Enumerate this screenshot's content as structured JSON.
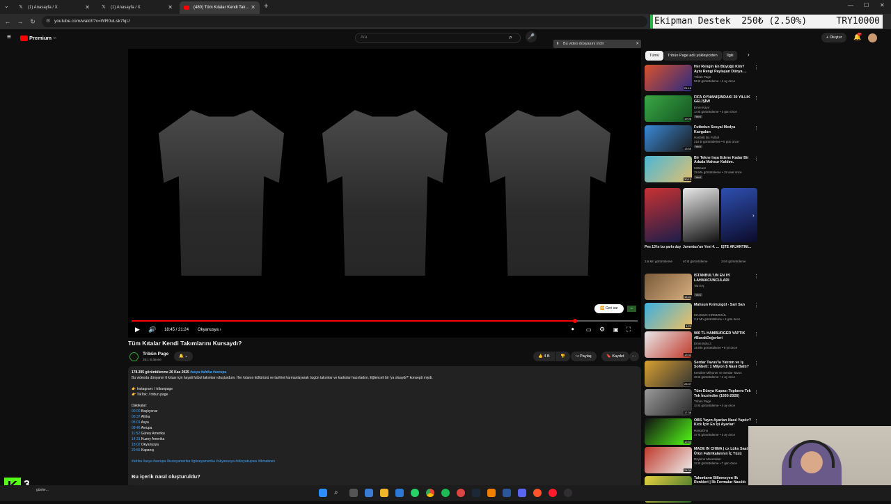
{
  "browser": {
    "tabs": [
      {
        "label": "(1) Anasayfa / X",
        "icon": "x-logo-icon"
      },
      {
        "label": "(1) Anasayfa / X",
        "icon": "x-logo-icon"
      },
      {
        "label": "(480) Tüm Kıtalar Kendi Tak...",
        "icon": "youtube-icon"
      }
    ],
    "url": "youtube.com/watch?v=WR0uLsk7lqU"
  },
  "ticker": {
    "text": "Ekipman Destek  250₺ (2.50%)",
    "goal": "TRY10000"
  },
  "youtube": {
    "brand": "Premium",
    "brand_sup": "TR",
    "search_placeholder": "Ara",
    "create_label": "Oluştur",
    "notif_count": "9+",
    "download_banner": "Bu video dosyasını indir",
    "video": {
      "time": "18:45 / 21:24",
      "chapter": "Okyanusya",
      "skip": "Geri sar",
      "progress": 0.876,
      "title": "Tüm Kıtalar Kendi Takımlarını Kursaydı?"
    },
    "channel": {
      "name": "Tribün Page",
      "subs": "25,1 B abone"
    },
    "actions": {
      "likes": "4 B",
      "share": "Paylaş",
      "save": "Kaydet"
    },
    "description": {
      "stats": "178.395 görüntülenme  26 Kas 2025",
      "tags_inline": "#asya #afrika #avrupa",
      "text": "Bu videoda dünyanın 6 kıtası için hayali futbol takımları oluşturdum. Her kıtanın kültürünü ve tarihini harmanlayarak özgün takımlar ve kadrolar hazırladım. Eğlenceli bir 'ya olsaydı?' konsepti miydi.",
      "instagram": "Instagram:  / tribunpage",
      "tiktok": "TikTok:  / tribun.page",
      "chapters_title": "Dakikalar:",
      "chapters": [
        {
          "t": "00:00",
          "l": "Başlıyoruz"
        },
        {
          "t": "00:37",
          "l": "Afrika"
        },
        {
          "t": "05:01",
          "l": "Asya"
        },
        {
          "t": "08:46",
          "l": "Avrupa"
        },
        {
          "t": "11:52",
          "l": "Güney Amerika"
        },
        {
          "t": "14:31",
          "l": "Kuzey Amerika"
        },
        {
          "t": "18:02",
          "l": "Okyanusya"
        },
        {
          "t": "20:55",
          "l": "Kapanış"
        }
      ],
      "hashtags": "#afrika #asya #avrupa #kuzeyamerika #güneyamerika #okyanusya #dünyakupası #tkmaknen",
      "section_title": "Bu içerik nasıl oluşturuldu?"
    },
    "chips": [
      "Tümü",
      "Tribün Page adlı yükleyiciden",
      "İlgili"
    ],
    "related_top": [
      {
        "title": "Her Rengin En Büyüğü Kim? Aynı Rengi Paylaşan Dünya ...",
        "channel": "Tribün Page",
        "meta": "56 B görüntüleme • 2 ay önce",
        "dur": "21:15",
        "badge": "",
        "c1": "#d9522b",
        "c2": "#2a2a80"
      },
      {
        "title": "FIFA OYNANIŞINDAKİ 30 YILLIK GELİŞİM!",
        "channel": "Emre Kayır",
        "meta": "14 B görüntüleme • 3 gün önce",
        "dur": "19:06",
        "badge": "Yeni",
        "c1": "#3aa845",
        "c2": "#145220"
      },
      {
        "title": "Futbolun Sosyal Medya Kavgaları",
        "channel": "Hasbilik Bu Futbol",
        "meta": "218 B görüntüleme • 6 gün önce",
        "dur": "13:55",
        "badge": "Yeni",
        "c1": "#3a8ad8",
        "c2": "#1a1a1a"
      },
      {
        "title": "Bir Tekne İnşa Edene Kadar Bir Adada Mahsur Kaldım.",
        "channel": "MrBeast",
        "meta": "29 Mn görüntüleme • 19 saat önce",
        "dur": "30:13",
        "badge": "Yeni",
        "c1": "#4bb7d6",
        "c2": "#e0c070"
      }
    ],
    "shorts": [
      {
        "title": "Pes 13'te bu şarkı duymu...",
        "meta": "2,6 Mn görüntüleme",
        "c1": "#c83232",
        "c2": "#1d1d4a"
      },
      {
        "title": "Juventus'un Yeni 4. ...",
        "meta": "40 B görüntüleme",
        "c1": "#e8e8e8",
        "c2": "#111111"
      },
      {
        "title": "İŞTE ARJANTİNİ...",
        "meta": "24 B görüntüleme",
        "c1": "#2e4fb0",
        "c2": "#0b0b2a"
      }
    ],
    "related_bottom": [
      {
        "title": "İSTANBUL'UN EN İYİ LAHMACUNCULARI",
        "channel": "Tat Grş",
        "meta": "",
        "dur": "15:41",
        "badge": "Yeni",
        "c1": "#7a5a3a",
        "c2": "#d8b080"
      },
      {
        "title": "Mahsun Kırmızıgül - Sari San",
        "channel": "MAHSUN KIRMIZIGÜL",
        "meta": "3,5 Mn görüntüleme • 4 gün önce",
        "dur": "4:23",
        "badge": "",
        "c1": "#3bb0e0",
        "c2": "#f0c060"
      },
      {
        "title": "900 TL HAMBURGER YAPTIK #BurakDeğerleri",
        "channel": "Emre Bolu 3",
        "meta": "16 Mn görüntüleme • 8 yıl önce",
        "dur": "13:32",
        "badge": "",
        "c1": "#e8e8e8",
        "c2": "#c0392b"
      },
      {
        "title": "Serdar Tavus'la Yatırım ve İş Sohbeti: 1 Milyon $ Nasıl Battı?",
        "channel": "Kendine Milyoner ve Serdar Tavus",
        "meta": "30 B görüntüleme • 4 ay önce",
        "dur": "28:37",
        "badge": "",
        "c1": "#d8a030",
        "c2": "#333333"
      },
      {
        "title": "Tüm Dünya Kupası Toplarını Tek Tek İnceledim (1930-2026)",
        "channel": "Tribün Page",
        "meta": "34 B görüntüleme • 4 ay önce",
        "dur": "17:38",
        "badge": "",
        "c1": "#9a9a9a",
        "c2": "#2a2a2a"
      },
      {
        "title": "OBS Yayın Ayarları Nasıl Yapılır? Kick İçin En İyi Ayarlar!",
        "channel": "HangiOnu",
        "meta": "37 B görüntüleme • 3 ay önce",
        "dur": "12:53",
        "badge": "",
        "c1": "#111111",
        "c2": "#53fc18"
      },
      {
        "title": "MADE IN CHINA | cx Lüks Saat Ürün Fabrikalarının İç Yüzü",
        "channel": "Röykine Maceraları",
        "meta": "32 B görüntüleme • 7 gün önce",
        "dur": "24:09",
        "badge": "",
        "c1": "#c0392b",
        "c2": "#eeeeee"
      },
      {
        "title": "Takımların Bilinmeyen İlk Renkleri | İlk Formalar Nasıldı",
        "channel": "",
        "meta": "",
        "dur": "",
        "badge": "",
        "c1": "#e8d040",
        "c2": "#2a6a2a"
      }
    ]
  },
  "overlay": {
    "kick_logo": "K",
    "kick_number": "3",
    "news": "günler..."
  },
  "colors": {
    "accent": "#ff0000",
    "link": "#3ea6ff",
    "kick": "#53fc18"
  }
}
